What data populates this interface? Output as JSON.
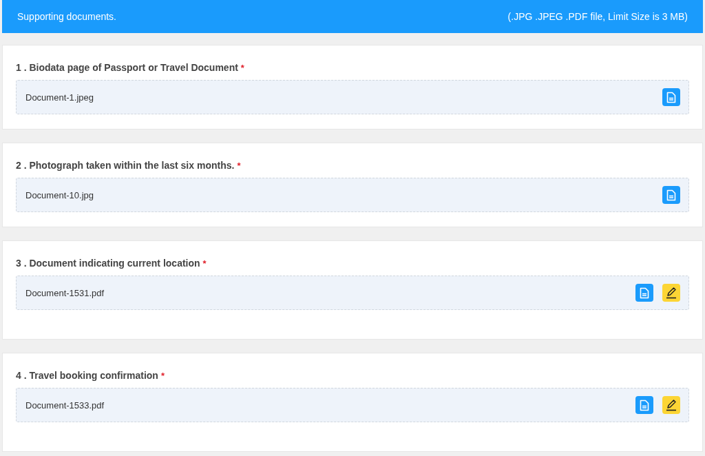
{
  "header": {
    "title": "Supporting documents.",
    "note": "(.JPG .JPEG .PDF file, Limit Size is 3 MB)"
  },
  "documents": [
    {
      "label": "1 . Biodata page of Passport or Travel Document",
      "required_mark": "*",
      "file": "Document-1.jpeg",
      "editable": false
    },
    {
      "label": "2 . Photograph taken within the last six months.",
      "required_mark": "*",
      "file": "Document-10.jpg",
      "editable": false
    },
    {
      "label": "3 . Document indicating current location",
      "required_mark": "*",
      "file": "Document-1531.pdf",
      "editable": true
    },
    {
      "label": "4 . Travel booking confirmation",
      "required_mark": "*",
      "file": "Document-1533.pdf",
      "editable": true
    }
  ]
}
